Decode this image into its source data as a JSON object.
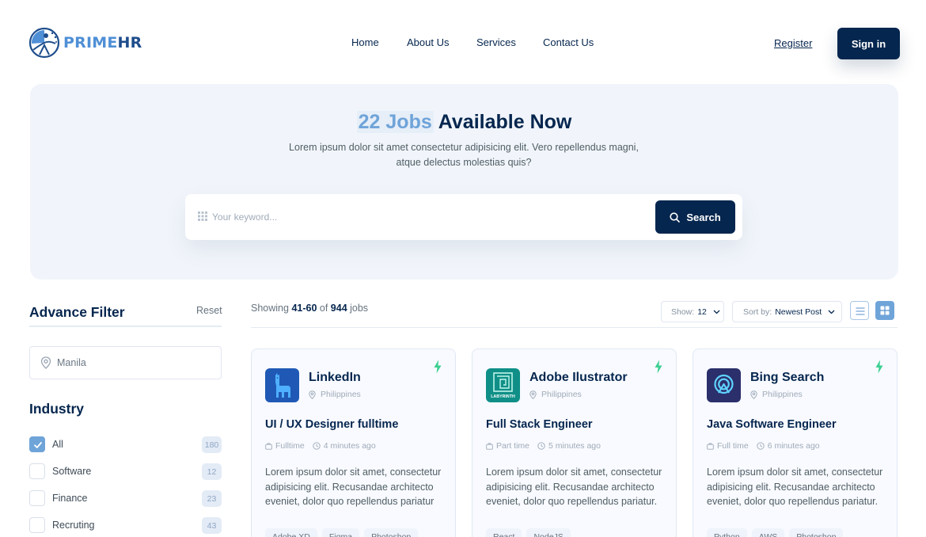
{
  "brand": {
    "name_part1": "PRIME",
    "name_part2": "HR"
  },
  "nav": {
    "items": [
      "Home",
      "About Us",
      "Services",
      "Contact Us"
    ]
  },
  "auth": {
    "register": "Register",
    "signin": "Sign in"
  },
  "hero": {
    "title_highlight": "22 Jobs",
    "title_rest": " Available Now",
    "description": "Lorem ipsum dolor sit amet consectetur adipisicing elit. Vero repellendus magni, atque delectus molestias quis?",
    "search_placeholder": "Your keyword...",
    "search_button": "Search"
  },
  "sidebar": {
    "title": "Advance Filter",
    "reset": "Reset",
    "location_value": "Manila",
    "industry_title": "Industry",
    "industries": [
      {
        "label": "All",
        "count": "180",
        "checked": true
      },
      {
        "label": "Software",
        "count": "12",
        "checked": false
      },
      {
        "label": "Finance",
        "count": "23",
        "checked": false
      },
      {
        "label": "Recruting",
        "count": "43",
        "checked": false
      }
    ]
  },
  "results": {
    "showing_prefix": "Showing ",
    "range": "41-60",
    "of": " of ",
    "total": "944",
    "suffix": " jobs",
    "show_label": "Show:",
    "show_value": "12",
    "sort_label": "Sort by:",
    "sort_value": "Newest Post"
  },
  "jobs": [
    {
      "company": "LinkedIn",
      "location": "Philippines",
      "title": "UI / UX Designer fulltime",
      "type": "Fulltime",
      "posted": "4 minutes ago",
      "description": "Lorem ipsum dolor sit amet, consectetur adipisicing elit. Recusandae architecto eveniet, dolor quo repellendus pariatur",
      "tags": [
        "Adobe XD",
        "Figma",
        "Photoshop"
      ],
      "logo_color": "#1f59b5",
      "logo_icon": "llama-icon"
    },
    {
      "company": "Adobe Ilustrator",
      "location": "Philippines",
      "title": "Full Stack Engineer",
      "type": "Part time",
      "posted": "5 minutes ago",
      "description": "Lorem ipsum dolor sit amet, consectetur adipisicing elit. Recusandae architecto eveniet, dolor quo repellendus pariatur.",
      "tags": [
        "React",
        "NodeJS"
      ],
      "logo_color": "#0f8f87",
      "logo_icon": "labyrinth-icon",
      "logo_text": "LABYRINTH"
    },
    {
      "company": "Bing Search",
      "location": "Philippines",
      "title": "Java Software Engineer",
      "type": "Full time",
      "posted": "6 minutes ago",
      "description": "Lorem ipsum dolor sit amet, consectetur adipisicing elit. Recusandae architecto eveniet, dolor quo repellendus pariatur.",
      "tags": [
        "Python",
        "AWS",
        "Photoshop"
      ],
      "logo_color": "#2b2f6b",
      "logo_icon": "signal-pin-icon"
    }
  ],
  "colors": {
    "primary": "#05264e",
    "accent": "#6fa4d9",
    "hero_bg": "#f1f5fb",
    "flash": "#3ccf91"
  }
}
